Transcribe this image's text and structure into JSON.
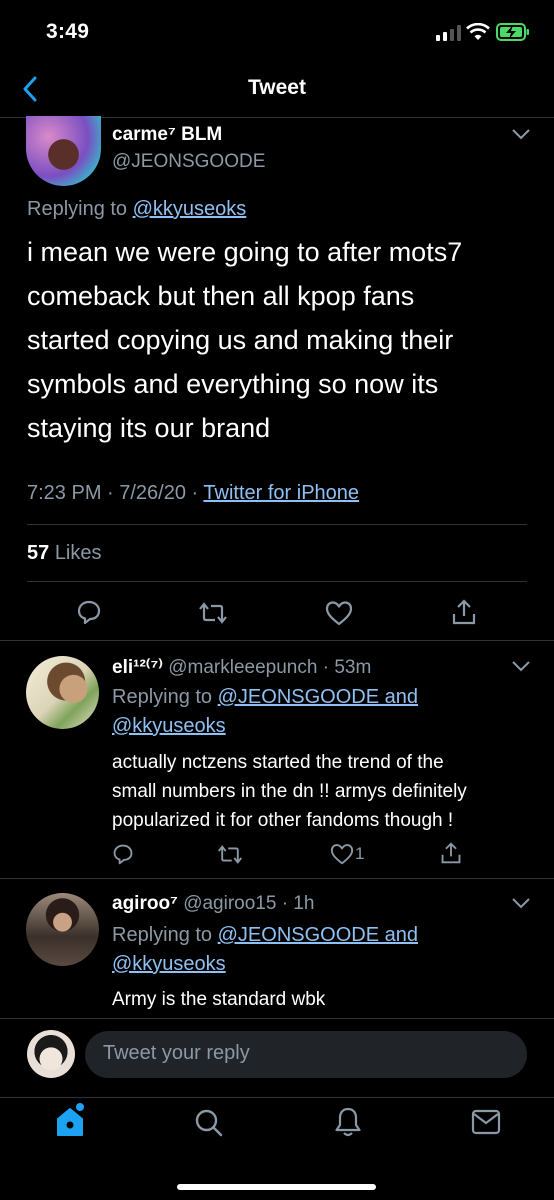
{
  "status_bar": {
    "time": "3:49"
  },
  "nav": {
    "title": "Tweet"
  },
  "main_tweet": {
    "name": "carme⁷ BLM",
    "handle": "@JEONSGOODE",
    "replying_prefix": "Replying to ",
    "replying_to": "@kkyuseoks",
    "text_lines": [
      "i mean we were going to after mots7",
      "comeback but then all kpop fans",
      "started copying us and making their",
      "symbols and everything so now its",
      "staying its our brand"
    ],
    "timestamp": "7:23 PM · 7/26/20 · ",
    "source": "Twitter for iPhone",
    "likes_count": "57",
    "likes_label": "Likes"
  },
  "replies": [
    {
      "name": "eli¹²⁽⁷⁾",
      "handle": "@markleeepunch · 53m",
      "replying_prefix": "Replying to ",
      "replying_line1": "@JEONSGOODE and",
      "replying_line2": "@kkyuseoks",
      "text_lines": [
        "actually nctzens started the trend of the",
        "small numbers in the dn !! armys definitely",
        "popularized it for other fandoms though !"
      ],
      "like_count": "1"
    },
    {
      "name": "agiroo⁷",
      "handle": "@agiroo15 · 1h",
      "replying_prefix": "Replying to ",
      "replying_line1": "@JEONSGOODE and",
      "replying_line2": "@kkyuseoks",
      "text_lines": [
        "Army is the standard wbk"
      ]
    }
  ],
  "compose": {
    "placeholder": "Tweet your reply"
  },
  "tab_bar": {
    "items": [
      "home-icon",
      "search-icon",
      "notifications-icon",
      "messages-icon"
    ]
  },
  "colors": {
    "accent": "#1da1f2",
    "link": "#8ec0f2",
    "muted": "#8b98a5",
    "battery": "#4cd964"
  }
}
